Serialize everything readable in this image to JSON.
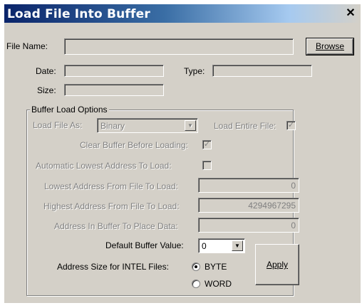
{
  "window": {
    "title": "Load File Into Buffer",
    "close_glyph": "✕"
  },
  "fields": {
    "file_name_label": "File Name:",
    "file_name_value": "",
    "browse_label": "Browse",
    "date_label": "Date:",
    "date_value": "",
    "type_label": "Type:",
    "type_value": "",
    "size_label": "Size:",
    "size_value": ""
  },
  "options": {
    "group_title": "Buffer Load Options",
    "load_file_as_label": "Load File As:",
    "load_file_as_value": "Binary",
    "load_entire_file_label": "Load Entire File:",
    "load_entire_file_checked": true,
    "clear_buffer_label": "Clear Buffer Before Loading:",
    "clear_buffer_checked": true,
    "auto_lowest_label": "Automatic Lowest Address To Load:",
    "auto_lowest_checked": false,
    "lowest_address_label": "Lowest Address From File To Load:",
    "lowest_address_value": "0",
    "highest_address_label": "Highest Address From File To Load:",
    "highest_address_value": "4294967295",
    "address_in_buffer_label": "Address In Buffer To Place Data:",
    "address_in_buffer_value": "0",
    "default_buffer_label": "Default Buffer Value:",
    "default_buffer_value": "0",
    "address_size_label": "Address Size for INTEL Files:",
    "address_size_options": [
      "BYTE",
      "WORD"
    ],
    "address_size_selected": "BYTE",
    "apply_label": "Apply"
  },
  "icons": {
    "check": "✓",
    "dropdown": "▼"
  }
}
